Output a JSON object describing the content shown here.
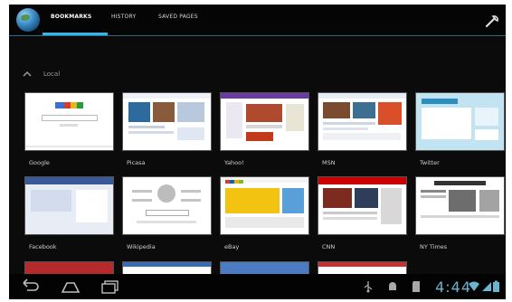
{
  "tabs": [
    {
      "label": "BOOKMARKS",
      "active": true
    },
    {
      "label": "HISTORY",
      "active": false
    },
    {
      "label": "SAVED PAGES",
      "active": false
    }
  ],
  "section": {
    "label": "Local"
  },
  "bookmarks": [
    {
      "label": "Google"
    },
    {
      "label": "Picasa"
    },
    {
      "label": "Yahoo!"
    },
    {
      "label": "MSN"
    },
    {
      "label": "Twitter"
    },
    {
      "label": "Facebook"
    },
    {
      "label": "Wikipedia"
    },
    {
      "label": "eBay"
    },
    {
      "label": "CNN"
    },
    {
      "label": "NY Times"
    }
  ],
  "status": {
    "time": "4:44"
  },
  "colors": {
    "accent": "#33b5e5",
    "background": "#0b0b0b"
  },
  "icons": [
    "globe-icon",
    "wrench-icon",
    "chevron-up-icon",
    "back-icon",
    "home-icon",
    "recent-apps-icon",
    "usb-icon",
    "android-debug-icon",
    "sd-card-icon",
    "wifi-icon",
    "signal-icon",
    "battery-icon"
  ]
}
